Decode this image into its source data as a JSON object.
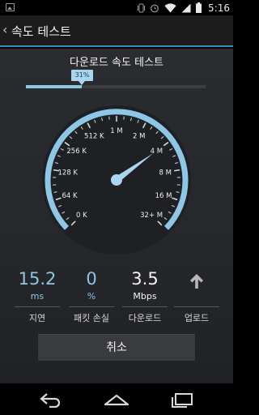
{
  "status_bar": {
    "time": "5:16",
    "icons": [
      "gallery-icon",
      "vibrate-icon",
      "alarm-icon",
      "wifi-icon",
      "signal-icon",
      "battery-icon"
    ]
  },
  "action_bar": {
    "back_icon": "chevron-left-icon",
    "title": "속도 테스트"
  },
  "test": {
    "title": "다운로드 속도 테스트",
    "progress_label": "31%",
    "progress_value": 0.31
  },
  "gauge": {
    "labels": [
      "0 K",
      "64 K",
      "128 K",
      "256 K",
      "512 K",
      "1 M",
      "2 M",
      "4 M",
      "8 M",
      "16 M",
      "32+ M"
    ],
    "needle_value": "4 M",
    "colors": {
      "arc": "#8ec6e6",
      "face": "#1e2024",
      "needle": "#a9d6ee"
    }
  },
  "stats": {
    "latency": {
      "value": "15.2",
      "unit": "ms",
      "label": "지연"
    },
    "packet_loss": {
      "value": "0",
      "unit": "%",
      "label": "패킷 손실"
    },
    "download": {
      "value": "3.5",
      "unit": "Mbps",
      "label": "다운로드"
    },
    "upload": {
      "icon": "arrow-up-icon",
      "label": "업로드"
    }
  },
  "cancel_button": {
    "label": "취소"
  },
  "nav_bar": {
    "icons": [
      "back-icon",
      "home-icon",
      "recents-icon"
    ]
  },
  "colors": {
    "accent": "#3a8fc0",
    "value_blue": "#8ec6e6"
  }
}
